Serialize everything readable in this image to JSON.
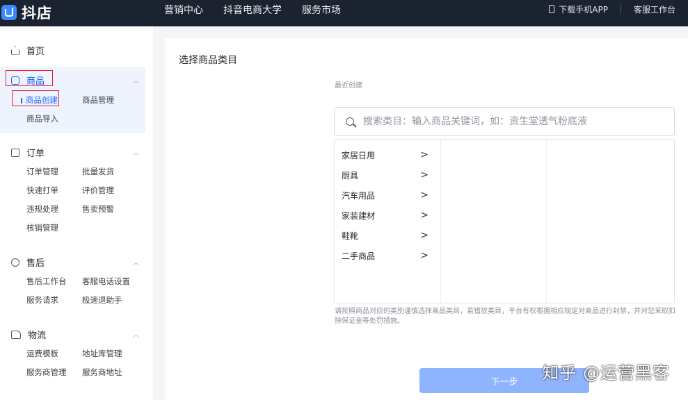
{
  "topbar": {
    "logo_text": "抖店",
    "nav": [
      "营销中心",
      "抖音电商大学",
      "服务市场"
    ],
    "download_app": "下载手机APP",
    "service_desk": "客服工作台"
  },
  "sidebar": {
    "home": "首页",
    "groups": [
      {
        "title": "商品",
        "items": [
          "商品创建",
          "商品管理",
          "商品导入"
        ]
      },
      {
        "title": "订单",
        "items": [
          "订单管理",
          "批量发货",
          "快速打单",
          "评价管理",
          "违规处理",
          "售卖预警",
          "核销管理"
        ]
      },
      {
        "title": "售后",
        "items": [
          "售后工作台",
          "客服电话设置",
          "服务请求",
          "极速退助手"
        ]
      },
      {
        "title": "物流",
        "items": [
          "运费模板",
          "地址库管理",
          "服务商管理",
          "服务商地址"
        ]
      }
    ]
  },
  "main": {
    "title": "选择商品类目",
    "recent_label": "最近创建",
    "search_placeholder": "搜索类目：输入商品关键词，如：资生堂透气粉底液",
    "categories": [
      "家居日用",
      "厨具",
      "汽车用品",
      "家装建材",
      "鞋靴",
      "二手商品"
    ],
    "notice": "请按照商品对应的类别谨慎选择商品类目，若错放类目，平台有权根据相应规定对商品进行封禁，并对您采取扣除保证金等处罚措施。",
    "next_button": "下一步"
  },
  "watermark": "知乎 @运营黑客"
}
